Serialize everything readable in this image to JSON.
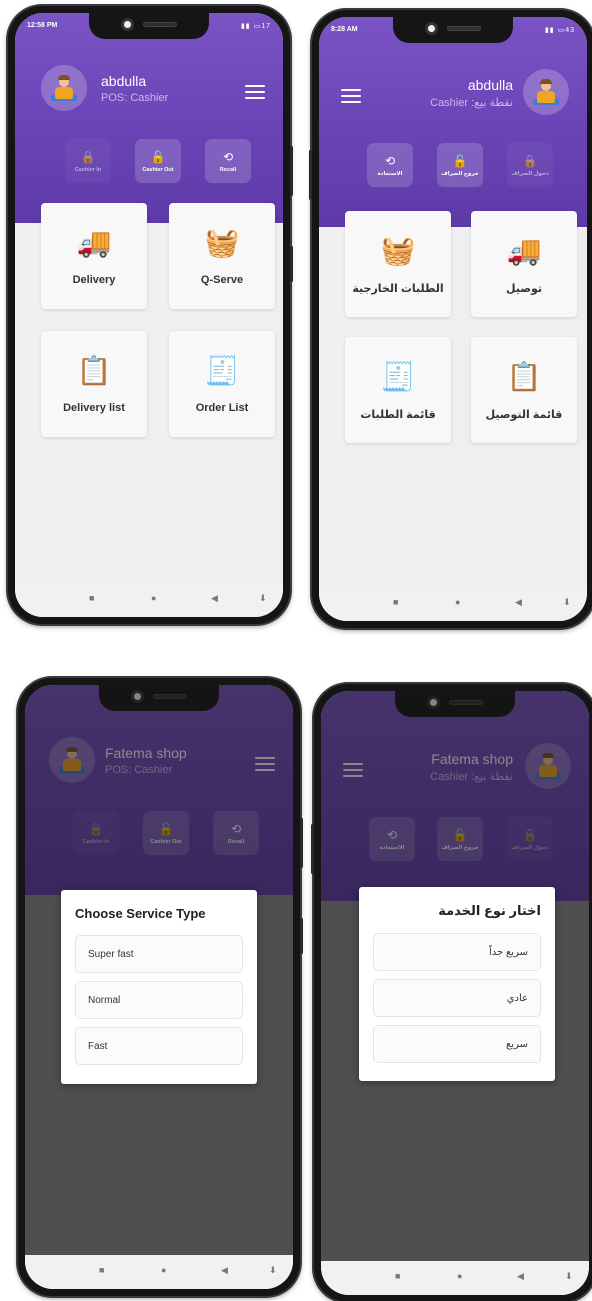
{
  "screens": [
    {
      "status_time": "12:58 PM",
      "status_icons": "▮▮ ▭17",
      "user_name": "abdulla",
      "user_role": "POS: Cashier",
      "quick_actions": [
        "Cashier In",
        "Cashier Out",
        "Recall"
      ],
      "tiles": [
        "Delivery",
        "Q-Serve",
        "Delivery list",
        "Order List"
      ]
    },
    {
      "status_time": "8:28 AM",
      "status_icons": "▮▮ ▭43",
      "user_name": "abdulla",
      "user_role": "Cashier :نقطة بيع",
      "quick_actions": [
        "الاستعادة",
        "خروج الصراف",
        "دخول الصراف"
      ],
      "tiles": [
        "الطلبات الخارجية",
        "توصيل",
        "قائمة الطلبات",
        "قائمة التوصيل"
      ]
    },
    {
      "user_name": "Fatema shop",
      "user_role": "POS: Cashier",
      "quick_actions": [
        "Cashier In",
        "Cashier Out",
        "Recall"
      ],
      "modal_title": "Choose Service Type",
      "options": [
        "Super fast",
        "Normal",
        "Fast"
      ]
    },
    {
      "user_name": "Fatema shop",
      "user_role": "Cashier :نقطة بيع",
      "quick_actions": [
        "الاستعادة",
        "خروج الصراف",
        "دخول الصراف"
      ],
      "modal_title": "اختار نوع الخدمة",
      "options": [
        "سريع جداً",
        "عادي",
        "سريع"
      ]
    }
  ],
  "nav_icons": [
    "■",
    "●",
    "◀",
    "⬇"
  ],
  "colors": {
    "header": "#6a44b6",
    "background": "#efeff1",
    "tile": "#f8f8f9"
  },
  "icons": {
    "delivery": "delivery-truck-icon",
    "qserve": "washing-machine-icon",
    "delivery_list": "clipboard-icon",
    "order_list": "order-calculator-icon"
  }
}
